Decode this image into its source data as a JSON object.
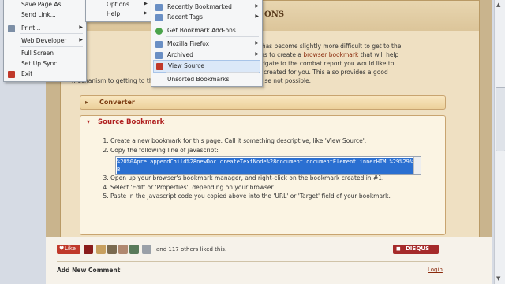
{
  "page": {
    "title_fragment": "ONS",
    "intro_line1_a": "pages, it has become slightly more difficult to get to the",
    "intro_line2_a": "nstructions to create a",
    "intro_link": "browser bookmark",
    "intro_line2_b": "that will help",
    "intro_line3": "imply navigate to the combat report you would like to",
    "intro_line4": "ce that is created for you. This also provides a good",
    "intro_line5": "mechanism to getting to th                 (smart-phones, etc) that was otherwise not possible.",
    "converter_label": "Converter",
    "source_label": "Source Bookmark",
    "steps": [
      "Create a new bookmark for this page. Call it something descriptive, like 'View Source'.",
      "Copy the following line of javascript:",
      "Open up your browser's bookmark manager, and right-click on the bookmark created in #1.",
      "Select 'Edit' or 'Properties', depending on your browser.",
      "Paste in the javascript code you copied above into the 'URL' or 'Target' field of your bookmark."
    ],
    "code_text": "%20%0Apre.appendChild%28newDoc.createTextNode%28document.documentElement.innerHTML%29%29%3B",
    "like_label": "Like",
    "liked_text": "and 117 others liked this.",
    "disqus_label": "DISQUS",
    "add_comment": "Add New Comment",
    "login": "Login"
  },
  "file_menu": {
    "items": [
      "Save Page As...",
      "Send Link...",
      "Print...",
      "Web Developer",
      "Full Screen",
      "Set Up Sync...",
      "Exit"
    ]
  },
  "top_menu": {
    "items": [
      "Options",
      "Help"
    ]
  },
  "bookmarks_menu": {
    "items": [
      "Recently Bookmarked",
      "Recent Tags",
      "Get Bookmark Add-ons",
      "Mozilla Firefox",
      "Archived",
      "View Source",
      "Unsorted Bookmarks"
    ]
  },
  "colors": {
    "accent": "#b02020",
    "selection": "#2a6fd1",
    "parchment": "#efe0c2"
  }
}
